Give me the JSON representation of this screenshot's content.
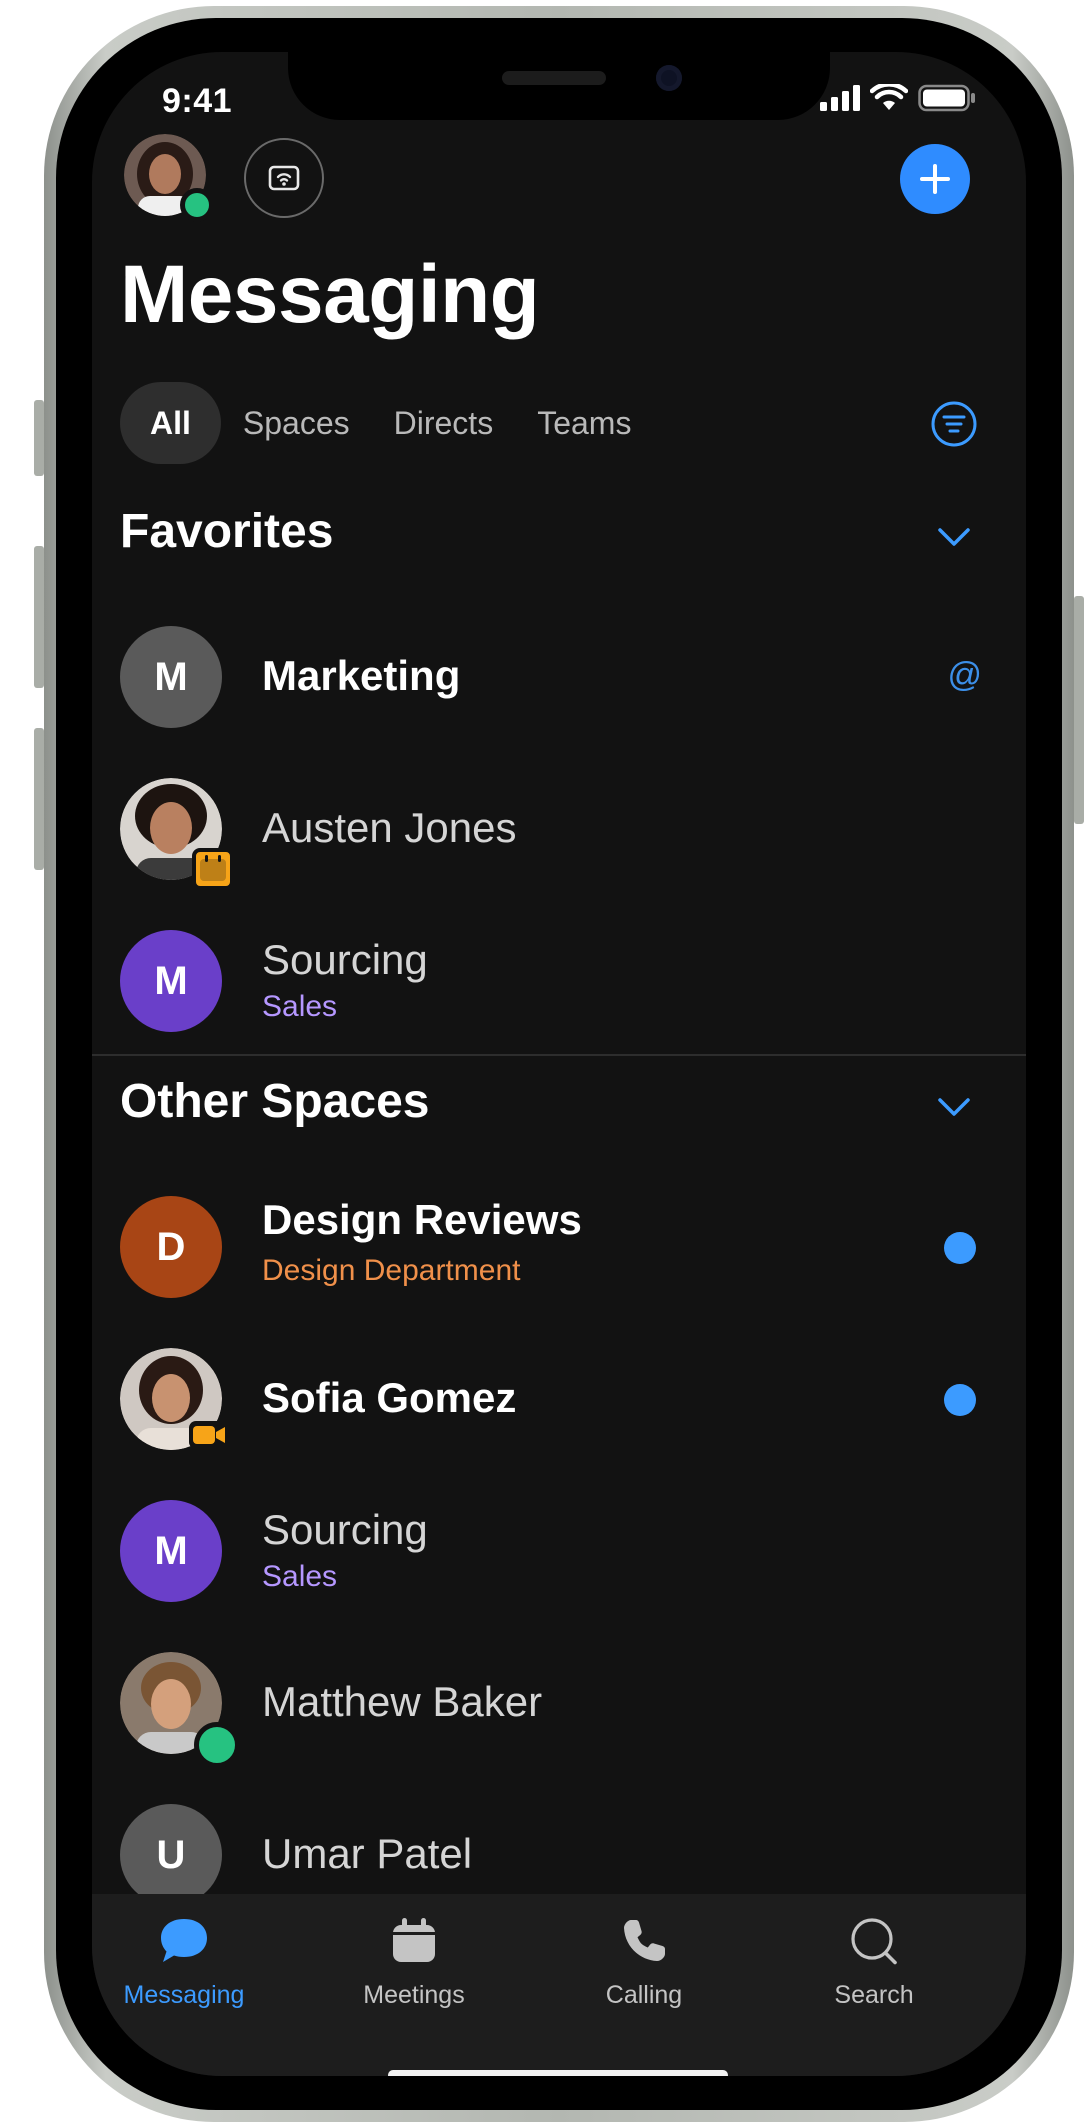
{
  "status_bar": {
    "time": "9:41"
  },
  "header": {
    "title": "Messaging"
  },
  "tabs": [
    {
      "label": "All",
      "active": true
    },
    {
      "label": "Spaces",
      "active": false
    },
    {
      "label": "Directs",
      "active": false
    },
    {
      "label": "Teams",
      "active": false
    }
  ],
  "favorites": {
    "title": "Favorites",
    "items": [
      {
        "initial": "M",
        "name": "Marketing",
        "bold": true,
        "indicator": "@",
        "avatar_color": "#5a5a5a"
      },
      {
        "name": "Austen Jones",
        "avatar": "photo",
        "badge": "calendar-icon"
      },
      {
        "initial": "M",
        "name": "Sourcing",
        "subtitle": "Sales",
        "subtitle_color": "#b597ff",
        "avatar_color": "#6a3fc9"
      }
    ]
  },
  "other_spaces": {
    "title": "Other Spaces",
    "items": [
      {
        "initial": "D",
        "name": "Design Reviews",
        "bold": true,
        "subtitle": "Design Department",
        "subtitle_color": "#f0904a",
        "avatar_color": "#a84515",
        "unread": true
      },
      {
        "name": "Sofia Gomez",
        "bold": true,
        "avatar": "photo",
        "badge": "video-icon",
        "unread": true
      },
      {
        "initial": "M",
        "name": "Sourcing",
        "subtitle": "Sales",
        "subtitle_color": "#b597ff",
        "avatar_color": "#6a3fc9"
      },
      {
        "name": "Matthew Baker",
        "avatar": "photo",
        "presence": "online"
      },
      {
        "initial": "U",
        "name": "Umar Patel",
        "avatar_color": "#5a5a5a"
      }
    ]
  },
  "tab_bar": [
    {
      "label": "Messaging",
      "icon": "chat-bubble-icon",
      "active": true
    },
    {
      "label": "Meetings",
      "icon": "calendar-icon",
      "active": false
    },
    {
      "label": "Calling",
      "icon": "phone-icon",
      "active": false
    },
    {
      "label": "Search",
      "icon": "search-icon",
      "active": false
    }
  ],
  "colors": {
    "accent": "#2f8cff",
    "unread": "#3c9bff",
    "presence": "#26c281",
    "background": "#121212"
  }
}
